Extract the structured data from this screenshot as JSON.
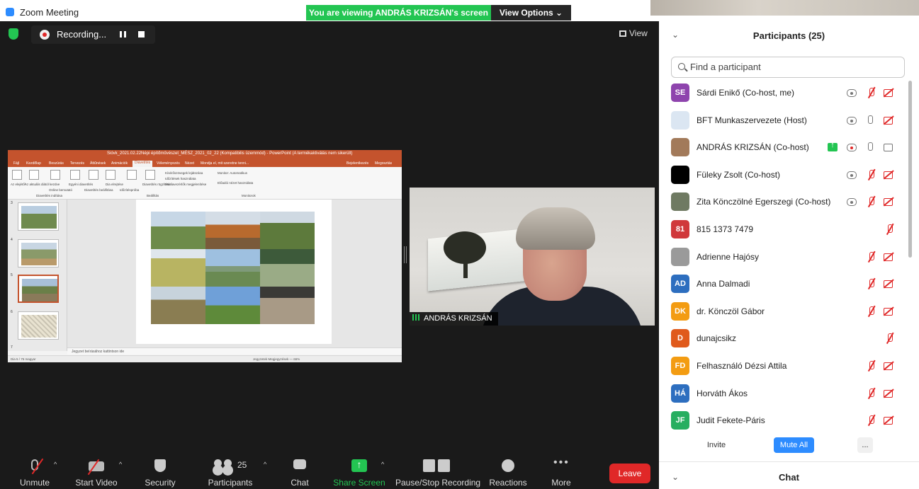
{
  "window": {
    "title": "Zoom Meeting"
  },
  "banner": {
    "viewing": "You are viewing ANDRÁS KRIZSÁN's screen",
    "view_options": "View Options ⌄"
  },
  "recording": {
    "status": "Recording..."
  },
  "view_button": {
    "label": "View"
  },
  "ppt": {
    "title": "Sióvk_2021.02.22Népi építőművészet_MÉSZ_2021_02_22 (Kompatibilis üzemmód) - PowerPoint (A termékaktiválás nem sikerült)",
    "tabs": [
      "Fájl",
      "Kezdőlap",
      "Beszúrás",
      "Tervezés",
      "Áttűnések",
      "Animációk",
      "Diavetítés",
      "Véleményezés",
      "Nézet",
      "Mondja el, mit szeretne tenni..."
    ],
    "active_tab": "Diavetítés",
    "tab_right": [
      "Bejelentkezés",
      "Megosztás"
    ],
    "ribbon_labels": [
      "Az elejétől",
      "Az aktuális diától kezdve",
      "Online bemutató",
      "Egyéni diavetítés",
      "Diavetítés beállítása",
      "Dia elrejtése",
      "Időzítéspróba",
      "Diavetítés rögzítése",
      "Kísérőszövegek lejátszása",
      "Időzítések használata",
      "Médiavezérlők megjelenítése",
      "Monitor: Automatikus",
      "Előadói nézet használata"
    ],
    "ribbon_groups": [
      "Diavetítés indítása",
      "Beállítás",
      "Monitorok"
    ],
    "slide_numbers": [
      "3",
      "4",
      "5",
      "6",
      "7"
    ],
    "notes_placeholder": "Jegyzet beírásához kattintson ide",
    "status_left": "Dia 5 / 75   magyar",
    "status_right": "Jegyzetek   Megjegyzések   —   66%"
  },
  "camera": {
    "name": "ANDRÁS KRIZSÁN"
  },
  "toolbar": {
    "unmute": "Unmute",
    "start_video": "Start Video",
    "security": "Security",
    "participants": "Participants",
    "participants_count": "25",
    "chat": "Chat",
    "share_screen": "Share Screen",
    "pause_stop": "Pause/Stop Recording",
    "reactions": "Reactions",
    "more": "More",
    "leave": "Leave"
  },
  "panel": {
    "title": "Participants (25)",
    "search_placeholder": "Find a participant",
    "participants": [
      {
        "initials": "SE",
        "name": "Sárdi Enikő (Co-host, me)",
        "color": "#8e44ad",
        "statuses": [
          "rec",
          "mute",
          "vidoff"
        ]
      },
      {
        "initials": "",
        "name": "BFT Munkaszervezete (Host)",
        "color": "#dbe6f2",
        "statuses": [
          "rec",
          "mic",
          "vidoff"
        ]
      },
      {
        "initials": "",
        "name": "ANDRÁS KRIZSÁN (Co-host)",
        "color": "#a27a5a",
        "statuses": [
          "share",
          "recred",
          "mic",
          "vidon"
        ]
      },
      {
        "initials": "",
        "name": "Füleky Zsolt (Co-host)",
        "color": "#000000",
        "statuses": [
          "rec",
          "mute",
          "vidoff"
        ]
      },
      {
        "initials": "",
        "name": "Zita Könczölné Egerszegi (Co-host)",
        "color": "#6f7a62",
        "statuses": [
          "rec",
          "mute",
          "vidoff"
        ]
      },
      {
        "initials": "81",
        "name": "815 1373 7479",
        "color": "#d0383b",
        "statuses": [
          "mute"
        ]
      },
      {
        "initials": "",
        "name": "Adrienne Hajósy",
        "color": "#9a9a9a",
        "statuses": [
          "mute",
          "vidoff"
        ]
      },
      {
        "initials": "AD",
        "name": "Anna Dalmadi",
        "color": "#2d6ebf",
        "statuses": [
          "mute",
          "vidoff"
        ]
      },
      {
        "initials": "DK",
        "name": "dr. Könczöl Gábor",
        "color": "#f39c12",
        "statuses": [
          "mute",
          "vidoff"
        ]
      },
      {
        "initials": "D",
        "name": "dunajcsikz",
        "color": "#e05a1c",
        "statuses": [
          "mute"
        ]
      },
      {
        "initials": "FD",
        "name": "Felhasználó Dézsi Attila",
        "color": "#f39c12",
        "statuses": [
          "mute",
          "vidoff"
        ]
      },
      {
        "initials": "HÁ",
        "name": "Horváth Ákos",
        "color": "#2d6ebf",
        "statuses": [
          "mute",
          "vidoff"
        ]
      },
      {
        "initials": "JF",
        "name": "Judit Fekete-Páris",
        "color": "#27ae60",
        "statuses": [
          "mute",
          "vidoff"
        ]
      }
    ],
    "invite": "Invite",
    "mute_all": "Mute All",
    "more": "..."
  },
  "chat_panel": {
    "title": "Chat"
  }
}
